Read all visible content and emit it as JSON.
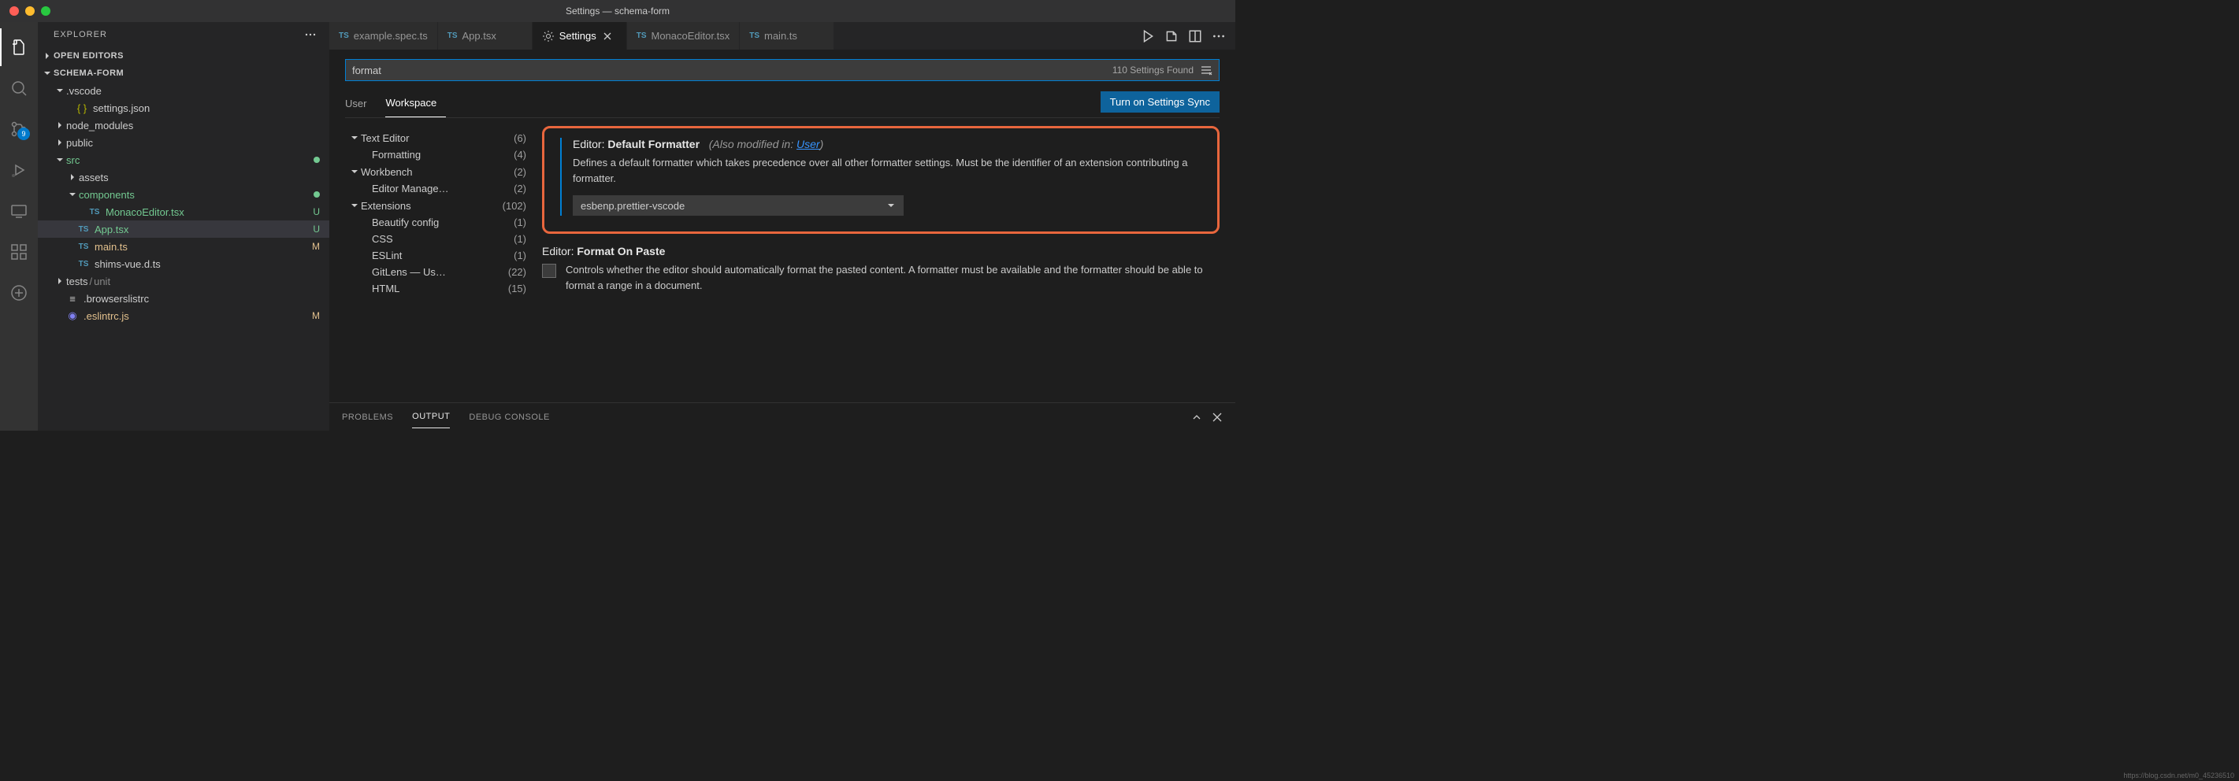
{
  "titlebar": {
    "title": "Settings — schema-form"
  },
  "activity": {
    "scm_badge": "9"
  },
  "sidebar": {
    "title": "EXPLORER",
    "open_editors": "OPEN EDITORS",
    "workspace": "SCHEMA-FORM",
    "tree": {
      "vscode": ".vscode",
      "settings_json": "settings.json",
      "node_modules": "node_modules",
      "public": "public",
      "src": "src",
      "assets": "assets",
      "components": "components",
      "monaco": "MonacoEditor.tsx",
      "app": "App.tsx",
      "main": "main.ts",
      "shims": "shims-vue.d.ts",
      "tests": "tests",
      "unit": "unit",
      "browserslist": ".browserslistrc",
      "eslintrc": ".eslintrc.js",
      "status_u": "U",
      "status_m": "M"
    }
  },
  "tabs": {
    "t1": "example.spec.ts",
    "t2": "App.tsx",
    "t3": "Settings",
    "t4": "MonacoEditor.tsx",
    "t5": "main.ts"
  },
  "settings": {
    "search_value": "format",
    "found": "110 Settings Found",
    "scope_user": "User",
    "scope_workspace": "Workspace",
    "sync": "Turn on Settings Sync",
    "toc": {
      "text_editor": "Text Editor",
      "text_editor_c": "(6)",
      "formatting": "Formatting",
      "formatting_c": "(4)",
      "workbench": "Workbench",
      "workbench_c": "(2)",
      "editor_mgmt": "Editor Manage…",
      "editor_mgmt_c": "(2)",
      "extensions": "Extensions",
      "extensions_c": "(102)",
      "beautify": "Beautify config",
      "beautify_c": "(1)",
      "css": "CSS",
      "css_c": "(1)",
      "eslint": "ESLint",
      "eslint_c": "(1)",
      "gitlens": "GitLens — Us…",
      "gitlens_c": "(22)",
      "html": "HTML",
      "html_c": "(15)"
    },
    "item1": {
      "title_prefix": "Editor:",
      "title": "Default Formatter",
      "also_prefix": "(Also modified in: ",
      "also_link": "User",
      "also_suffix": ")",
      "desc": "Defines a default formatter which takes precedence over all other formatter settings. Must be the identifier of an extension contributing a formatter.",
      "value": "esbenp.prettier-vscode"
    },
    "item2": {
      "title_prefix": "Editor:",
      "title": "Format On Paste",
      "desc": "Controls whether the editor should automatically format the pasted content. A formatter must be available and the formatter should be able to format a range in a document."
    }
  },
  "panel": {
    "problems": "PROBLEMS",
    "output": "OUTPUT",
    "debug_console": "DEBUG CONSOLE"
  },
  "watermark": "https://blog.csdn.net/m0_45236510"
}
